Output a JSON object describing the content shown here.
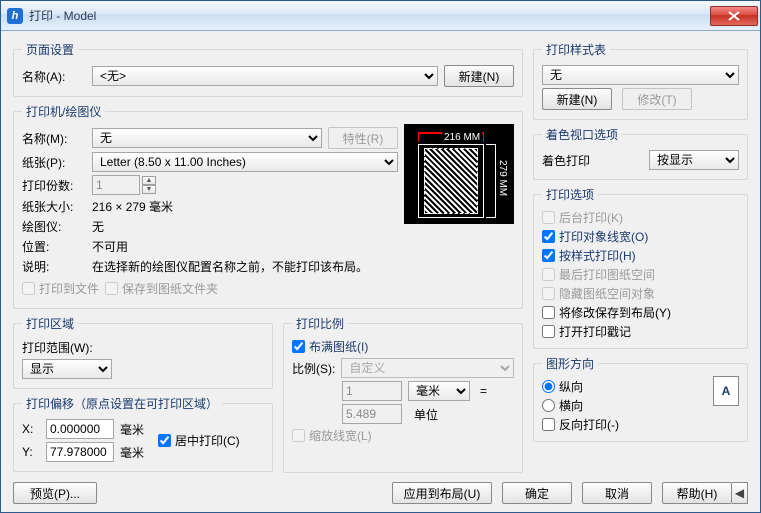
{
  "window": {
    "title": "打印 - Model"
  },
  "pageSetup": {
    "legend": "页面设置",
    "name_label": "名称(A):",
    "name_value": "<无>",
    "new_btn": "新建(N)"
  },
  "printer": {
    "legend": "打印机/绘图仪",
    "name_label": "名称(M):",
    "name_value": "无",
    "props_btn": "特性(R)",
    "paper_label": "纸张(P):",
    "paper_value": "Letter (8.50 x 11.00 Inches)",
    "copies_label": "打印份数:",
    "copies_value": "1",
    "size_label": "纸张大小:",
    "size_value": "216 × 279  毫米",
    "plotter_label": "绘图仪:",
    "plotter_value": "无",
    "location_label": "位置:",
    "location_value": "不可用",
    "desc_label": "说明:",
    "desc_value": "在选择新的绘图仪配置名称之前，不能打印该布局。",
    "to_file": "打印到文件",
    "save_sheet": "保存到图纸文件夹",
    "preview_w": "216 MM",
    "preview_h": "279 MM"
  },
  "area": {
    "legend": "打印区域",
    "range_label": "打印范围(W):",
    "range_value": "显示"
  },
  "scale": {
    "legend": "打印比例",
    "fit": "布满图纸(I)",
    "ratio_label": "比例(S):",
    "ratio_value": "自定义",
    "num": "1",
    "unit_sel": "毫米",
    "eq": "=",
    "den": "5.489",
    "den_unit": "单位",
    "scale_lw": "缩放线宽(L)"
  },
  "offset": {
    "legend": "打印偏移（原点设置在可打印区域）",
    "x_label": "X:",
    "x_value": "0.000000",
    "y_label": "Y:",
    "y_value": "77.978000",
    "unit": "毫米",
    "center": "居中打印(C)"
  },
  "styleTable": {
    "legend": "打印样式表",
    "value": "无",
    "new_btn": "新建(N)",
    "edit_btn": "修改(T)"
  },
  "shaded": {
    "legend": "着色视口选项",
    "label": "着色打印",
    "value": "按显示"
  },
  "options": {
    "legend": "打印选项",
    "bg": "后台打印(K)",
    "lw": "打印对象线宽(O)",
    "bystyle": "按样式打印(H)",
    "paperspace_last": "最后打印图纸空间",
    "hide_ps": "隐藏图纸空间对象",
    "save_layout": "将修改保存到布局(Y)",
    "stamp": "打开打印戳记"
  },
  "orient": {
    "legend": "图形方向",
    "portrait": "纵向",
    "landscape": "横向",
    "upside": "反向打印(-)",
    "glyph": "A"
  },
  "footer": {
    "preview": "预览(P)...",
    "apply": "应用到布局(U)",
    "ok": "确定",
    "cancel": "取消",
    "help": "帮助(H)"
  }
}
